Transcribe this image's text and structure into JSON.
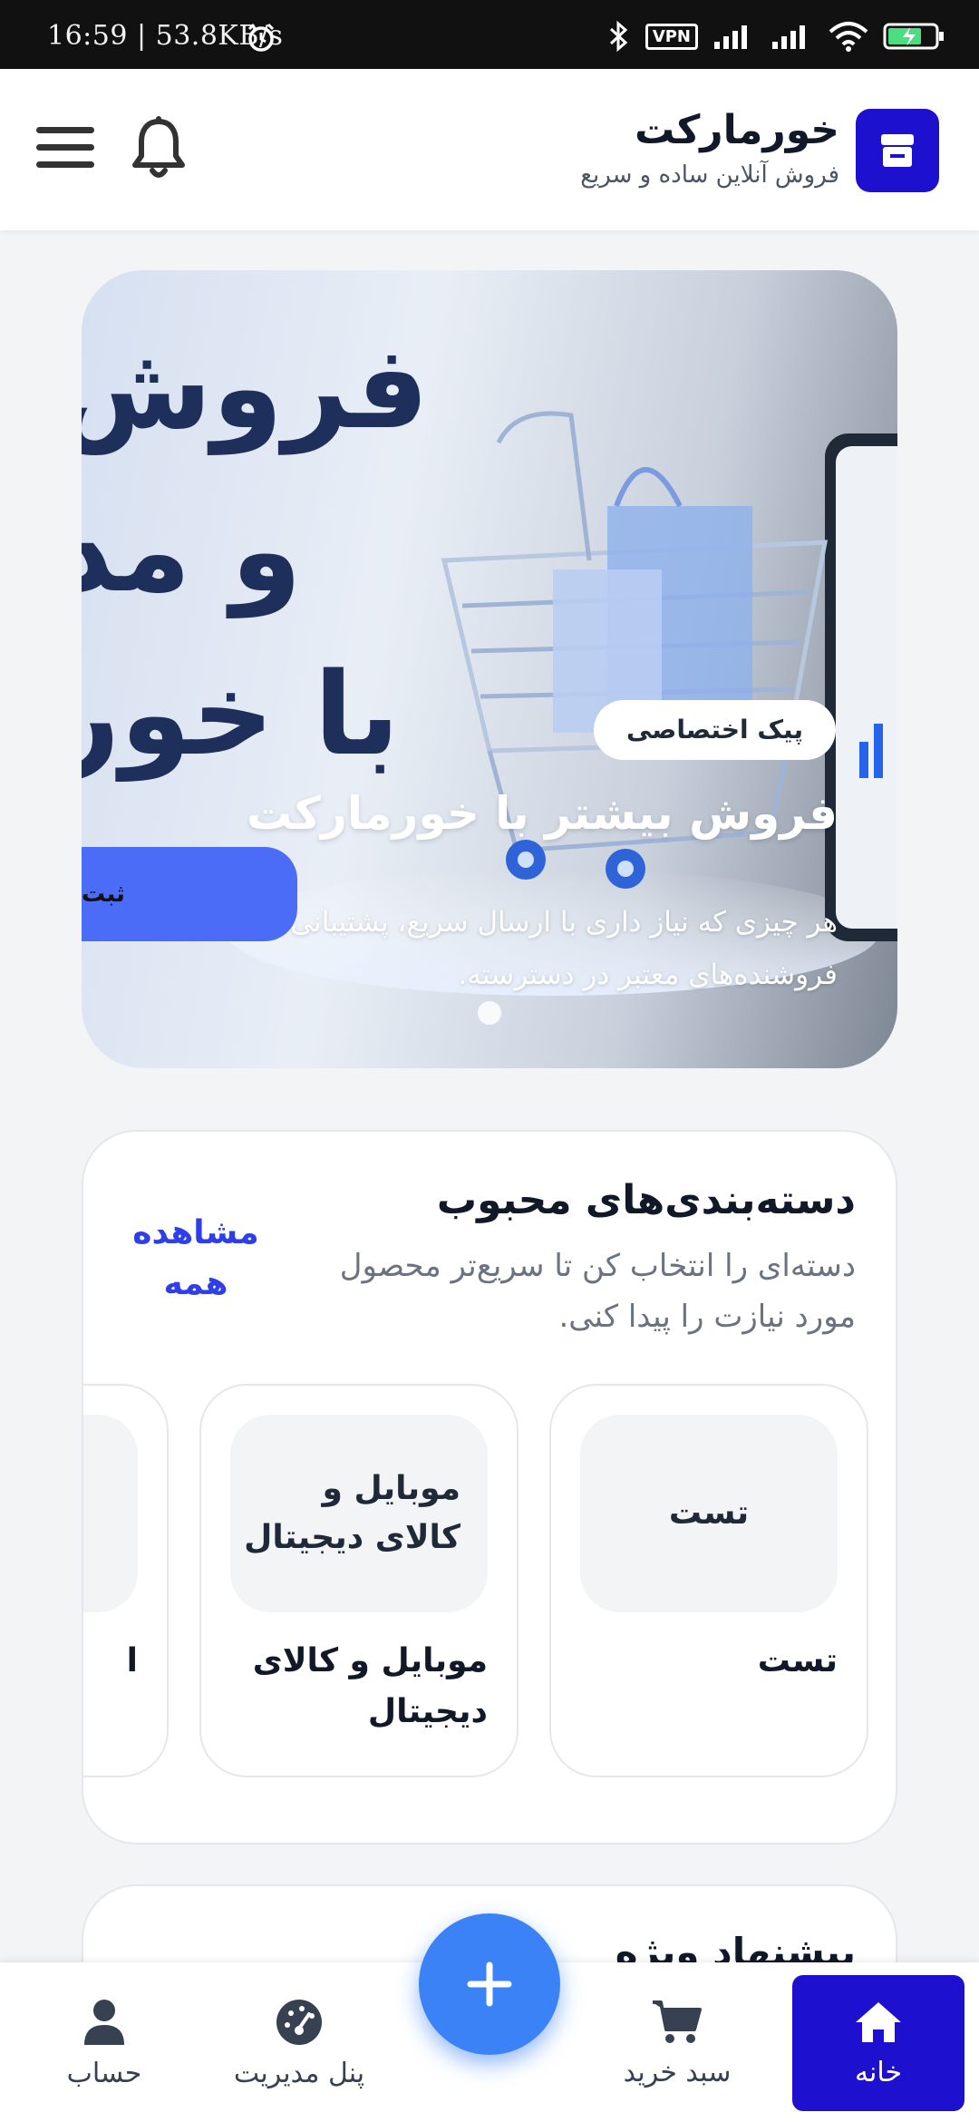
{
  "status_bar": {
    "time": "16:59 | 53.8KB/s",
    "vpn_label": "VPN",
    "icons": [
      "alarm-icon",
      "bluetooth-icon",
      "vpn-icon",
      "signal-icon",
      "signal-icon",
      "wifi-icon",
      "battery-charging-icon"
    ]
  },
  "header": {
    "brand_name": "خورمارکت",
    "tagline": "فروش آنلاین ساده و سریع",
    "logo_icon": "store-icon",
    "menu_icon": "hamburger-menu-icon",
    "bell_icon": "bell-icon"
  },
  "hero": {
    "slide_text": [
      "فروش",
      "و مد",
      "با خور"
    ],
    "badge": "پیک اختصاصی",
    "title": "فروش بیشتر با خورمارکت",
    "description": "هر چیزی که نیاز داری با ارسال سریع، پشتیبانی محلی و فروشنده‌های معتبر در دسترسته.",
    "cta_label": "ثبت",
    "colors": {
      "cta": "#4a6cf7",
      "heading": "#1e2f5c"
    }
  },
  "categories": {
    "title": "دسته‌بندی‌های محبوب",
    "subtitle": "دسته‌ای را انتخاب کن تا سریع‌تر محصول مورد نیازت را پیدا کنی.",
    "view_all": "مشاهده همه",
    "items": [
      {
        "thumb": "تست",
        "label": "تست"
      },
      {
        "thumb": "موبایل و کالای دیجیتال",
        "label": "موبایل و کالای دیجیتال"
      },
      {
        "thumb": "",
        "label": "ا"
      }
    ]
  },
  "special_offer": {
    "title": "پیشنهاد ویژه"
  },
  "bottom_nav": {
    "items": [
      {
        "label": "خانه",
        "icon": "home-icon",
        "active": true
      },
      {
        "label": "سبد خرید",
        "icon": "cart-icon",
        "active": false
      },
      {
        "label": "پنل مدیریت",
        "icon": "dashboard-gauge-icon",
        "active": false
      },
      {
        "label": "حساب",
        "icon": "user-icon",
        "active": false
      }
    ],
    "fab_icon": "plus-icon"
  },
  "colors": {
    "brand": "#1d10cf",
    "link": "#2f3fe8",
    "fab": "#3b82f6"
  }
}
